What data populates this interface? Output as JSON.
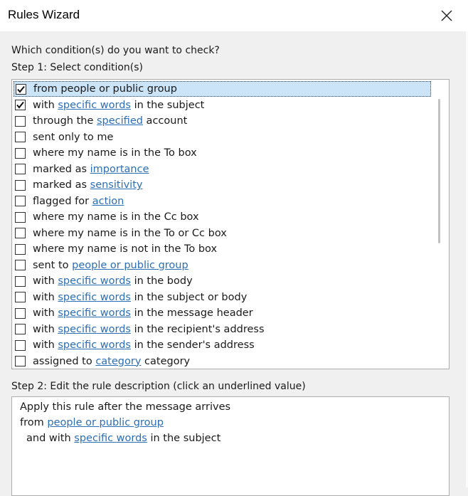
{
  "window": {
    "title": "Rules Wizard",
    "close_icon": "close-icon"
  },
  "step1": {
    "question": "Which condition(s) do you want to check?",
    "heading": "Step 1: Select condition(s)"
  },
  "conditions": [
    {
      "checked": true,
      "selected": true,
      "pre": "from people or public group",
      "link": "",
      "post": ""
    },
    {
      "checked": true,
      "selected": false,
      "pre": "with ",
      "link": "specific words",
      "post": " in the subject"
    },
    {
      "checked": false,
      "selected": false,
      "pre": "through the ",
      "link": "specified",
      "post": " account"
    },
    {
      "checked": false,
      "selected": false,
      "pre": "sent only to me",
      "link": "",
      "post": ""
    },
    {
      "checked": false,
      "selected": false,
      "pre": "where my name is in the To box",
      "link": "",
      "post": ""
    },
    {
      "checked": false,
      "selected": false,
      "pre": "marked as ",
      "link": "importance",
      "post": ""
    },
    {
      "checked": false,
      "selected": false,
      "pre": "marked as ",
      "link": "sensitivity",
      "post": ""
    },
    {
      "checked": false,
      "selected": false,
      "pre": "flagged for ",
      "link": "action",
      "post": ""
    },
    {
      "checked": false,
      "selected": false,
      "pre": "where my name is in the Cc box",
      "link": "",
      "post": ""
    },
    {
      "checked": false,
      "selected": false,
      "pre": "where my name is in the To or Cc box",
      "link": "",
      "post": ""
    },
    {
      "checked": false,
      "selected": false,
      "pre": "where my name is not in the To box",
      "link": "",
      "post": ""
    },
    {
      "checked": false,
      "selected": false,
      "pre": "sent to ",
      "link": "people or public group",
      "post": ""
    },
    {
      "checked": false,
      "selected": false,
      "pre": "with ",
      "link": "specific words",
      "post": " in the body"
    },
    {
      "checked": false,
      "selected": false,
      "pre": "with ",
      "link": "specific words",
      "post": " in the subject or body"
    },
    {
      "checked": false,
      "selected": false,
      "pre": "with ",
      "link": "specific words",
      "post": " in the message header"
    },
    {
      "checked": false,
      "selected": false,
      "pre": "with ",
      "link": "specific words",
      "post": " in the recipient's address"
    },
    {
      "checked": false,
      "selected": false,
      "pre": "with ",
      "link": "specific words",
      "post": " in the sender's address"
    },
    {
      "checked": false,
      "selected": false,
      "pre": "assigned to ",
      "link": "category",
      "post": " category"
    }
  ],
  "step2": {
    "heading": "Step 2: Edit the rule description (click an underlined value)",
    "line1": "Apply this rule after the message arrives",
    "line2_pre": "from ",
    "line2_link": "people or public group",
    "line3_pre": "and with ",
    "line3_link": "specific words",
    "line3_post": " in the subject"
  },
  "colors": {
    "link": "#2c6eb5",
    "selection": "#cce4f7",
    "background": "#f0f0f0"
  }
}
